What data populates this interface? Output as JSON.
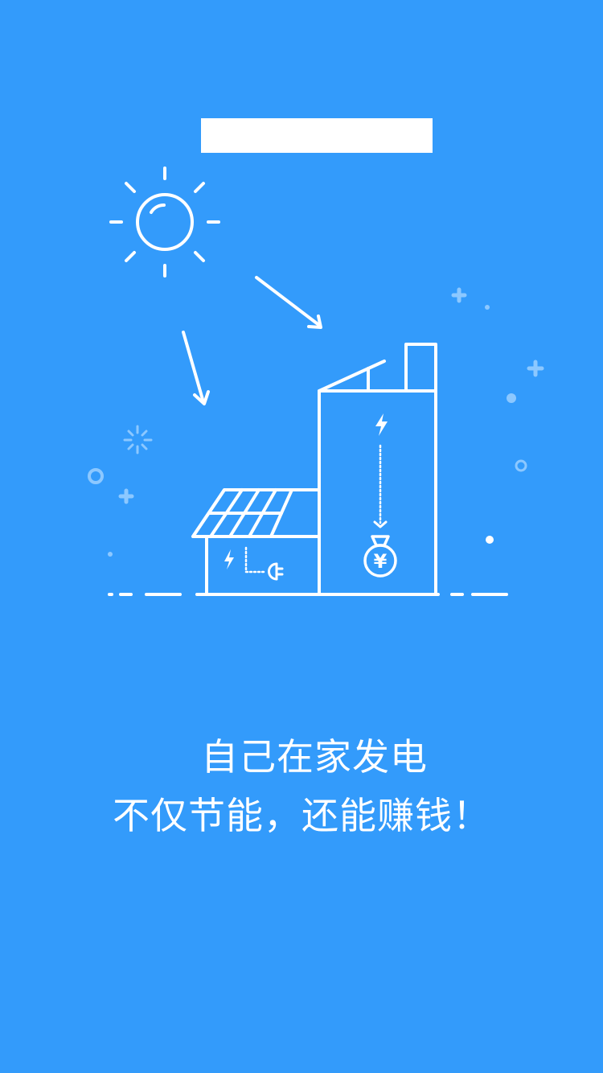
{
  "colors": {
    "background": "#339bfb",
    "foreground": "#ffffff",
    "sparkle": "#8cc8ff"
  },
  "illustration": {
    "subject": "house with solar panel and power plant building",
    "sun_icon": "sun-icon",
    "lightning_icons": [
      "lightning-icon",
      "lightning-icon"
    ],
    "money_bag_icon": "yuan-money-bag-icon",
    "plug_icon": "plug-icon",
    "money_symbol": "¥"
  },
  "headline": {
    "line1": "自己在家发电",
    "line2": "不仅节能，还能赚钱！"
  }
}
